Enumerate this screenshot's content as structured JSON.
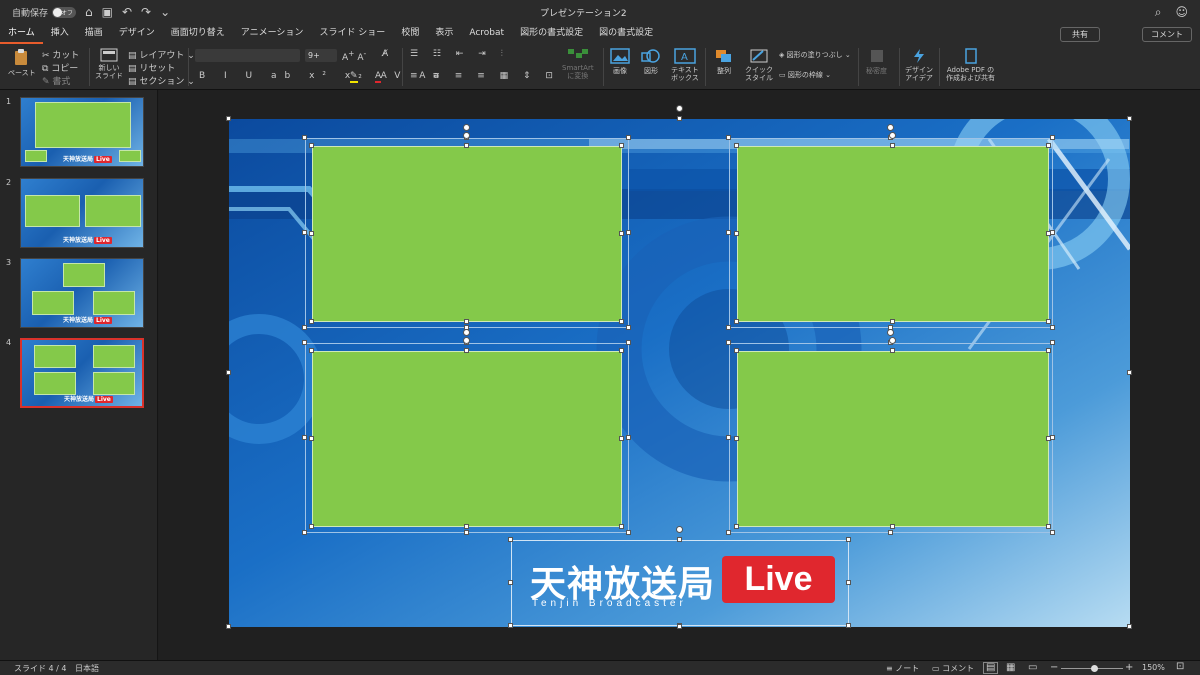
{
  "titlebar": {
    "autosave_label": "自動保存",
    "autosave_state": "オフ",
    "doc_title": "プレゼンテーション2"
  },
  "tabs": [
    "ホーム",
    "挿入",
    "描画",
    "デザイン",
    "画面切り替え",
    "アニメーション",
    "スライド ショー",
    "校閲",
    "表示",
    "Acrobat",
    "図形の書式設定",
    "図の書式設定"
  ],
  "header_buttons": {
    "share": "共有",
    "comment": "コメント"
  },
  "ribbon": {
    "paste": "ペースト",
    "cut": "カット",
    "copy": "コピー",
    "format": "書式",
    "new_slide": "新しい\nスライド",
    "layout": "レイアウト",
    "reset": "リセット",
    "section": "セクション",
    "font_size": "9+",
    "smartart": "SmartArt\nに変換",
    "picture": "画像",
    "shapes": "図形",
    "textbox": "テキスト\nボックス",
    "arrange": "整列",
    "quick_styles": "クイック\nスタイル",
    "shape_fill": "図形の塗りつぶし",
    "shape_outline": "図形の枠線",
    "sensitivity": "秘密度",
    "design_ideas": "デザイン\nアイデア",
    "adobe_pdf": "Adobe PDF の\n作成および共有"
  },
  "slides": [
    {
      "num": "1"
    },
    {
      "num": "2"
    },
    {
      "num": "3"
    },
    {
      "num": "4"
    }
  ],
  "logo": {
    "main": "天神放送局",
    "live": "Live",
    "sub": "Tenjin Broadcaster"
  },
  "status": {
    "slide": "スライド 4 / 4",
    "language": "日本語",
    "notes": "ノート",
    "comments": "コメント",
    "zoom": "150%"
  },
  "colors": {
    "panel_green": "#84c94a",
    "live_red": "#e0272e",
    "accent_tab": "#e85c2c"
  }
}
